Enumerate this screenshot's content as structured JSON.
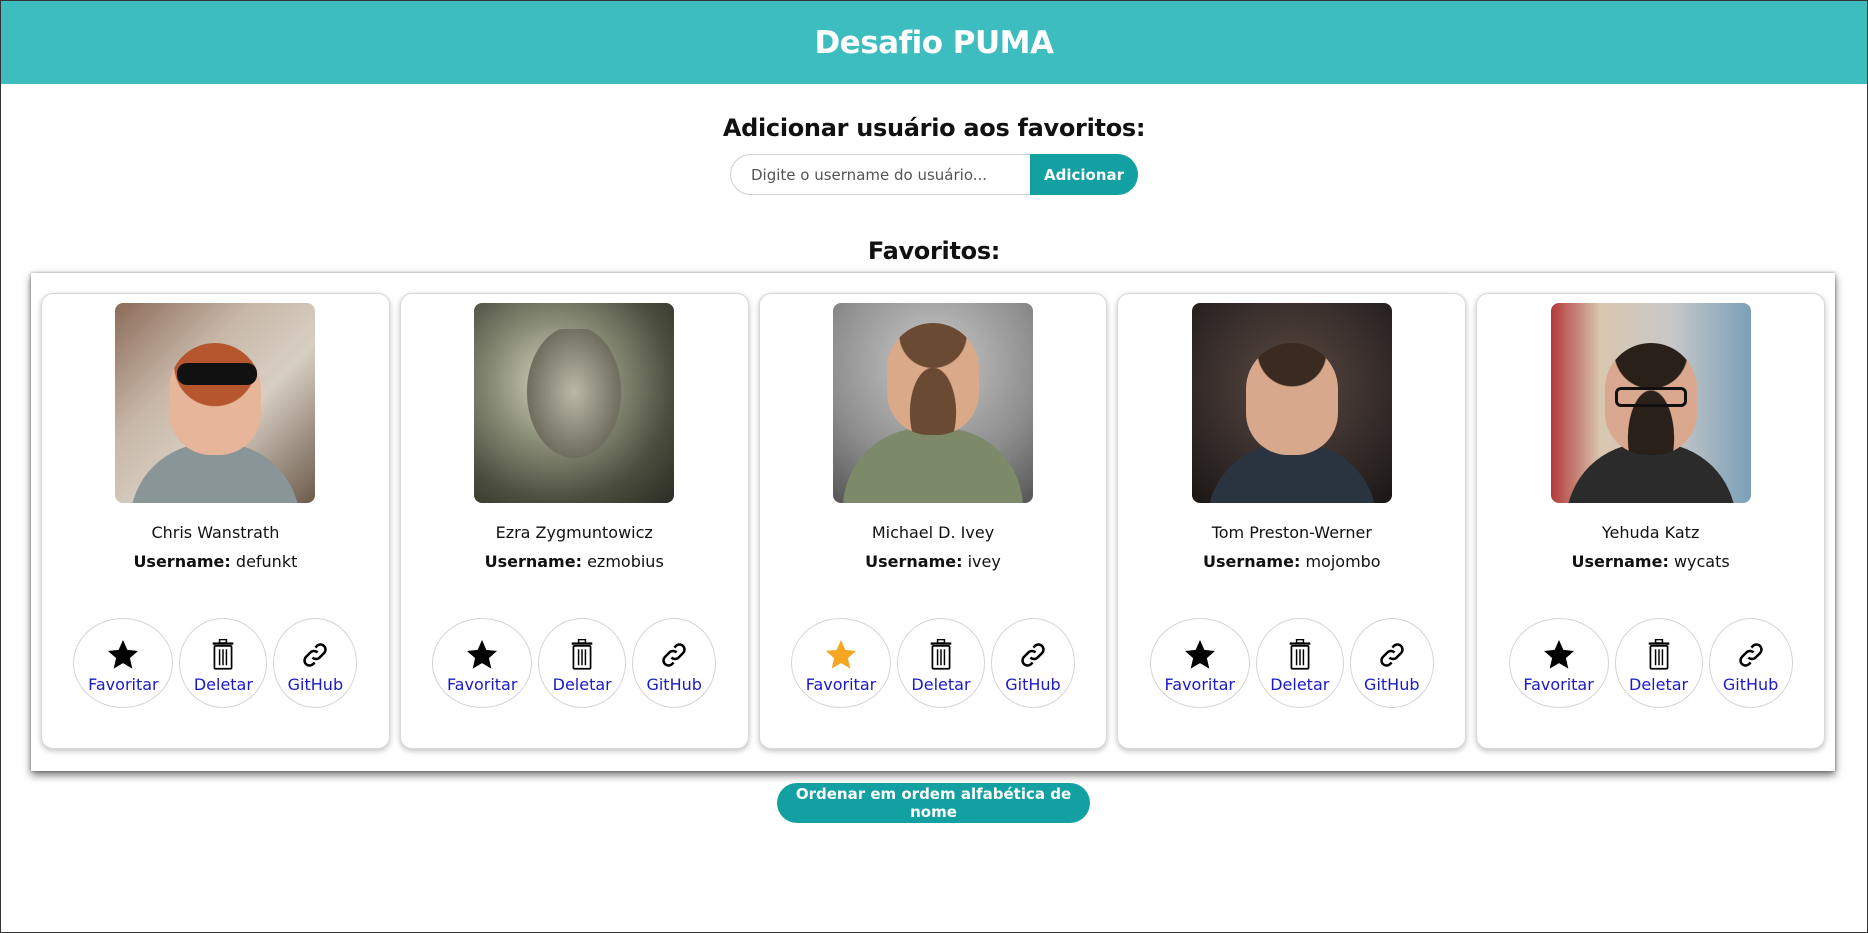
{
  "header": {
    "title": "Desafio PUMA"
  },
  "add_section": {
    "title": "Adicionar usuário aos favoritos:",
    "input_placeholder": "Digite o username do usuário...",
    "input_value": "",
    "button_label": "Adicionar"
  },
  "favorites": {
    "title": "Favoritos:",
    "username_prefix": "Username:",
    "cards": [
      {
        "name": "Chris Wanstrath",
        "username": "defunkt",
        "favorited": false,
        "fav_label": "Favoritar",
        "del_label": "Deletar",
        "git_label": "GitHub"
      },
      {
        "name": "Ezra Zygmuntowicz",
        "username": "ezmobius",
        "favorited": false,
        "fav_label": "Favoritar",
        "del_label": "Deletar",
        "git_label": "GitHub"
      },
      {
        "name": "Michael D. Ivey",
        "username": "ivey",
        "favorited": true,
        "fav_label": "Favoritar",
        "del_label": "Deletar",
        "git_label": "GitHub"
      },
      {
        "name": "Tom Preston-Werner",
        "username": "mojombo",
        "favorited": false,
        "fav_label": "Favoritar",
        "del_label": "Deletar",
        "git_label": "GitHub"
      },
      {
        "name": "Yehuda Katz",
        "username": "wycats",
        "favorited": false,
        "fav_label": "Favoritar",
        "del_label": "Deletar",
        "git_label": "GitHub"
      }
    ]
  },
  "sort_button": {
    "label": "Ordenar em ordem alfabética de nome"
  },
  "colors": {
    "header_bg": "#3dbdbf",
    "accent_button": "#12a0a2",
    "star_active": "#f5a623",
    "star_inactive": "#000000",
    "link_text": "#1a1ac8"
  }
}
